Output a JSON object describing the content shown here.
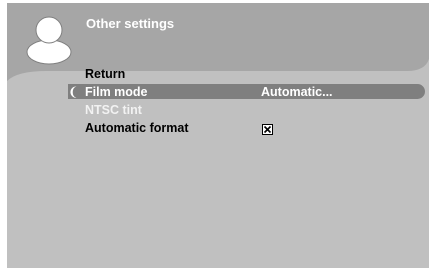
{
  "header": {
    "title": "Other settings",
    "icon": "user-avatar-icon"
  },
  "menu": {
    "items": [
      {
        "label": "Return",
        "value": "",
        "selected": false,
        "enabled": true
      },
      {
        "label": "Film mode",
        "value": "Automatic...",
        "selected": true,
        "enabled": true
      },
      {
        "label": "NTSC tint",
        "value": "",
        "selected": false,
        "enabled": false
      },
      {
        "label": "Automatic format",
        "value": "",
        "selected": false,
        "enabled": true,
        "checked": true
      }
    ],
    "selector_glyph": "❨"
  },
  "colors": {
    "panel": "#c0c0c0",
    "header": "#a6a6a6",
    "highlight": "#7f7f7f",
    "text": "#000000",
    "text_inverse": "#ffffff"
  }
}
